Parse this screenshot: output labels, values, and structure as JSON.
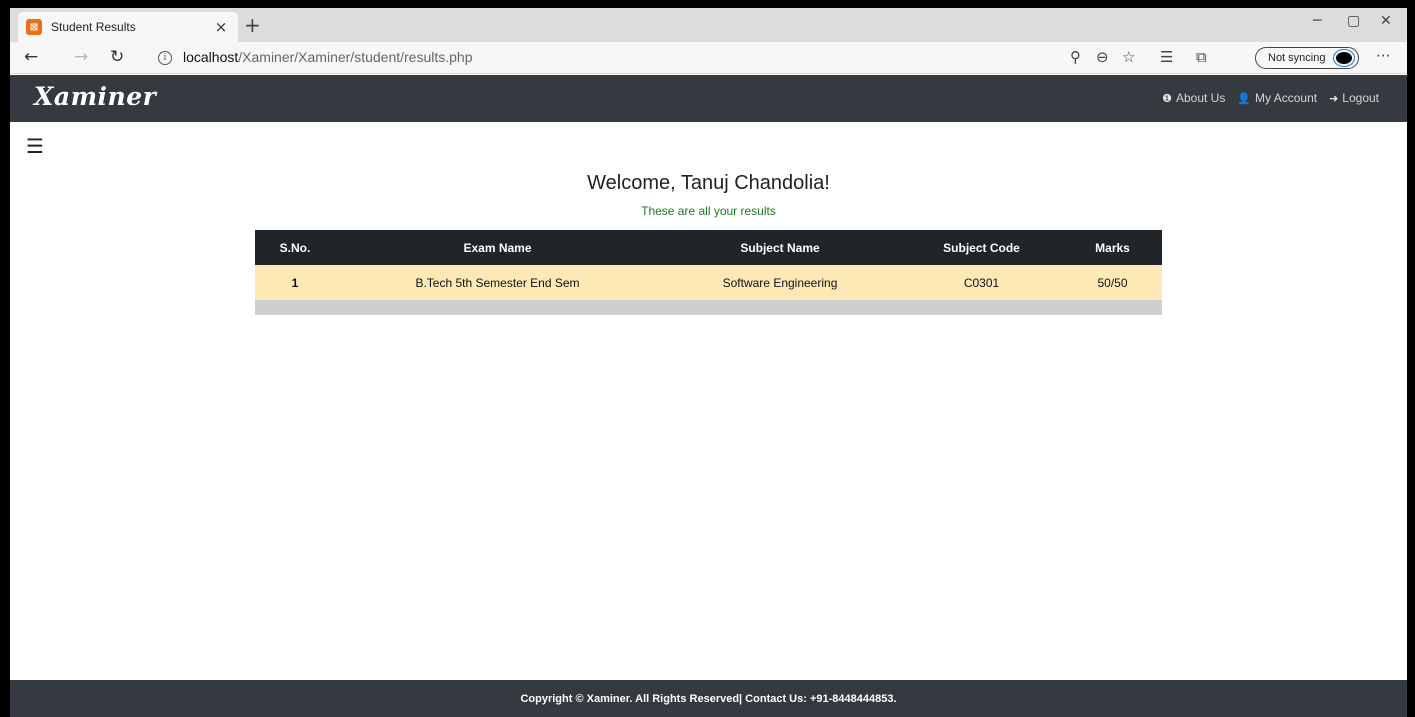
{
  "browser": {
    "tab_title": "Student Results",
    "tab_close": "×",
    "new_tab": "+",
    "url_host": "localhost",
    "url_path": "/Xaminer/Xaminer/student/results.php",
    "sync_label": "Not syncing",
    "more_label": "···"
  },
  "navbar": {
    "brand": "Xaminer",
    "about": "About Us",
    "account": "My Account",
    "logout": "Logout"
  },
  "page": {
    "welcome": "Welcome, Tanuj Chandolia!",
    "subtitle": "These are all your results"
  },
  "table": {
    "headers": [
      "S.No.",
      "Exam Name",
      "Subject Name",
      "Subject Code",
      "Marks"
    ],
    "rows": [
      [
        "1",
        "B.Tech 5th Semester End Sem",
        "Software Engineering",
        "C0301",
        "50/50"
      ]
    ]
  },
  "footer": {
    "text": "Copyright © Xaminer. All Rights Reserved| Contact Us: +91-8448444853."
  },
  "colors": {
    "navbar_bg": "#343a40",
    "table_header_bg": "#212529",
    "row_bg": "#fde9b5",
    "subtitle": "#1e7a1e"
  },
  "icons": [
    "tab-favicon-icon",
    "back-icon",
    "forward-icon",
    "refresh-icon",
    "info-icon",
    "zoom-icon",
    "zoom-out-icon",
    "favorite-icon",
    "favorites-list-icon",
    "collections-icon",
    "info-circle-icon",
    "user-icon",
    "logout-icon",
    "hamburger-icon"
  ]
}
